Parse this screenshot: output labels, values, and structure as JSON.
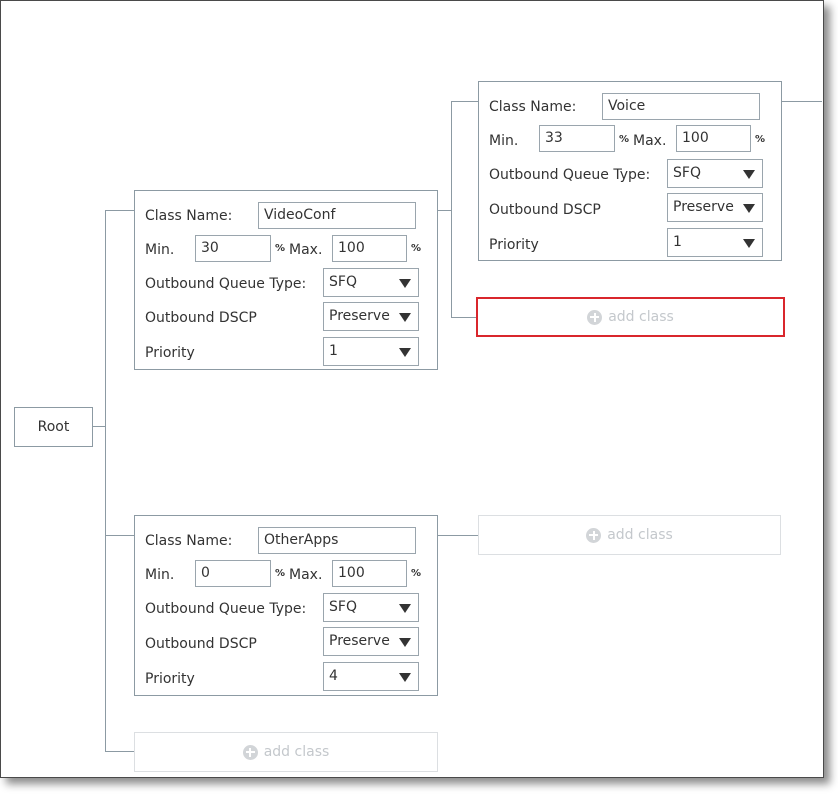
{
  "root": {
    "label": "Root"
  },
  "labels": {
    "class_name": "Class Name:",
    "min": "Min.",
    "max": "Max.",
    "percent": "%",
    "queue_type": "Outbound Queue Type:",
    "dscp": "Outbound DSCP",
    "priority": "Priority"
  },
  "classes": [
    {
      "name": "VideoConf",
      "min": "30",
      "max": "100",
      "queue_type": "SFQ",
      "dscp": "Preserve",
      "priority": "1"
    },
    {
      "name": "Voice",
      "min": "33",
      "max": "100",
      "queue_type": "SFQ",
      "dscp": "Preserve",
      "priority": "1"
    },
    {
      "name": "OtherApps",
      "min": "0",
      "max": "100",
      "queue_type": "SFQ",
      "dscp": "Preserve",
      "priority": "4"
    }
  ],
  "add_class": {
    "label": "add class",
    "icon": "plus-circle-icon"
  },
  "colors": {
    "connector": "#8c9aa3",
    "selected_border": "#d9262c",
    "add_class_text": "#c4c8cc"
  }
}
